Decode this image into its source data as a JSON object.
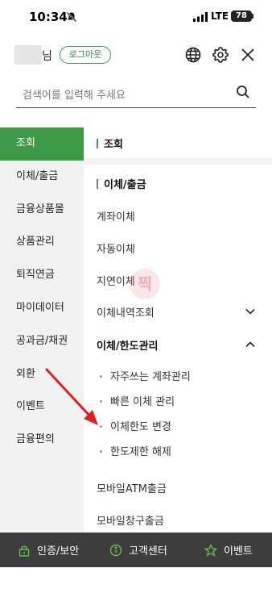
{
  "status_bar": {
    "time": "10:34",
    "network": "LTE",
    "battery": "78"
  },
  "header": {
    "username_suffix": "님",
    "logout_label": "로그아웃"
  },
  "search": {
    "placeholder": "검색어를 입력해 주세요"
  },
  "sidebar": {
    "items": [
      {
        "label": "조회",
        "active": true
      },
      {
        "label": "이체/출금"
      },
      {
        "label": "금융상품몰"
      },
      {
        "label": "상품관리"
      },
      {
        "label": "퇴직연금"
      },
      {
        "label": "마이데이터"
      },
      {
        "label": "공과금/채권"
      },
      {
        "label": "외환"
      },
      {
        "label": "이벤트"
      },
      {
        "label": "금융편의"
      }
    ]
  },
  "content": {
    "section_inquiry": "조회",
    "section_transfer": "이체/출금",
    "items": {
      "account_transfer": "계좌이체",
      "auto_transfer": "자동이체",
      "delayed_transfer": "지연이체",
      "transfer_history": "이체내역조회",
      "transfer_limit_mgmt": "이체/한도관리",
      "mobile_atm": "모바일ATM출금",
      "mobile_counter": "모바일창구출금"
    },
    "sub_items": {
      "frequent_accounts": "자주쓰는 계좌관리",
      "quick_transfer": "빠른 이체 관리",
      "limit_change": "이체한도 변경",
      "limit_release": "한도제한 해제"
    },
    "watermark": "찍"
  },
  "bottom_bar": {
    "auth_security": "인증/보안",
    "customer_center": "고객센터",
    "event": "이벤트"
  },
  "colors": {
    "accent": "#3f9a48",
    "annotation_arrow": "#e02020",
    "bottom_bar": "#3d3d3d"
  }
}
